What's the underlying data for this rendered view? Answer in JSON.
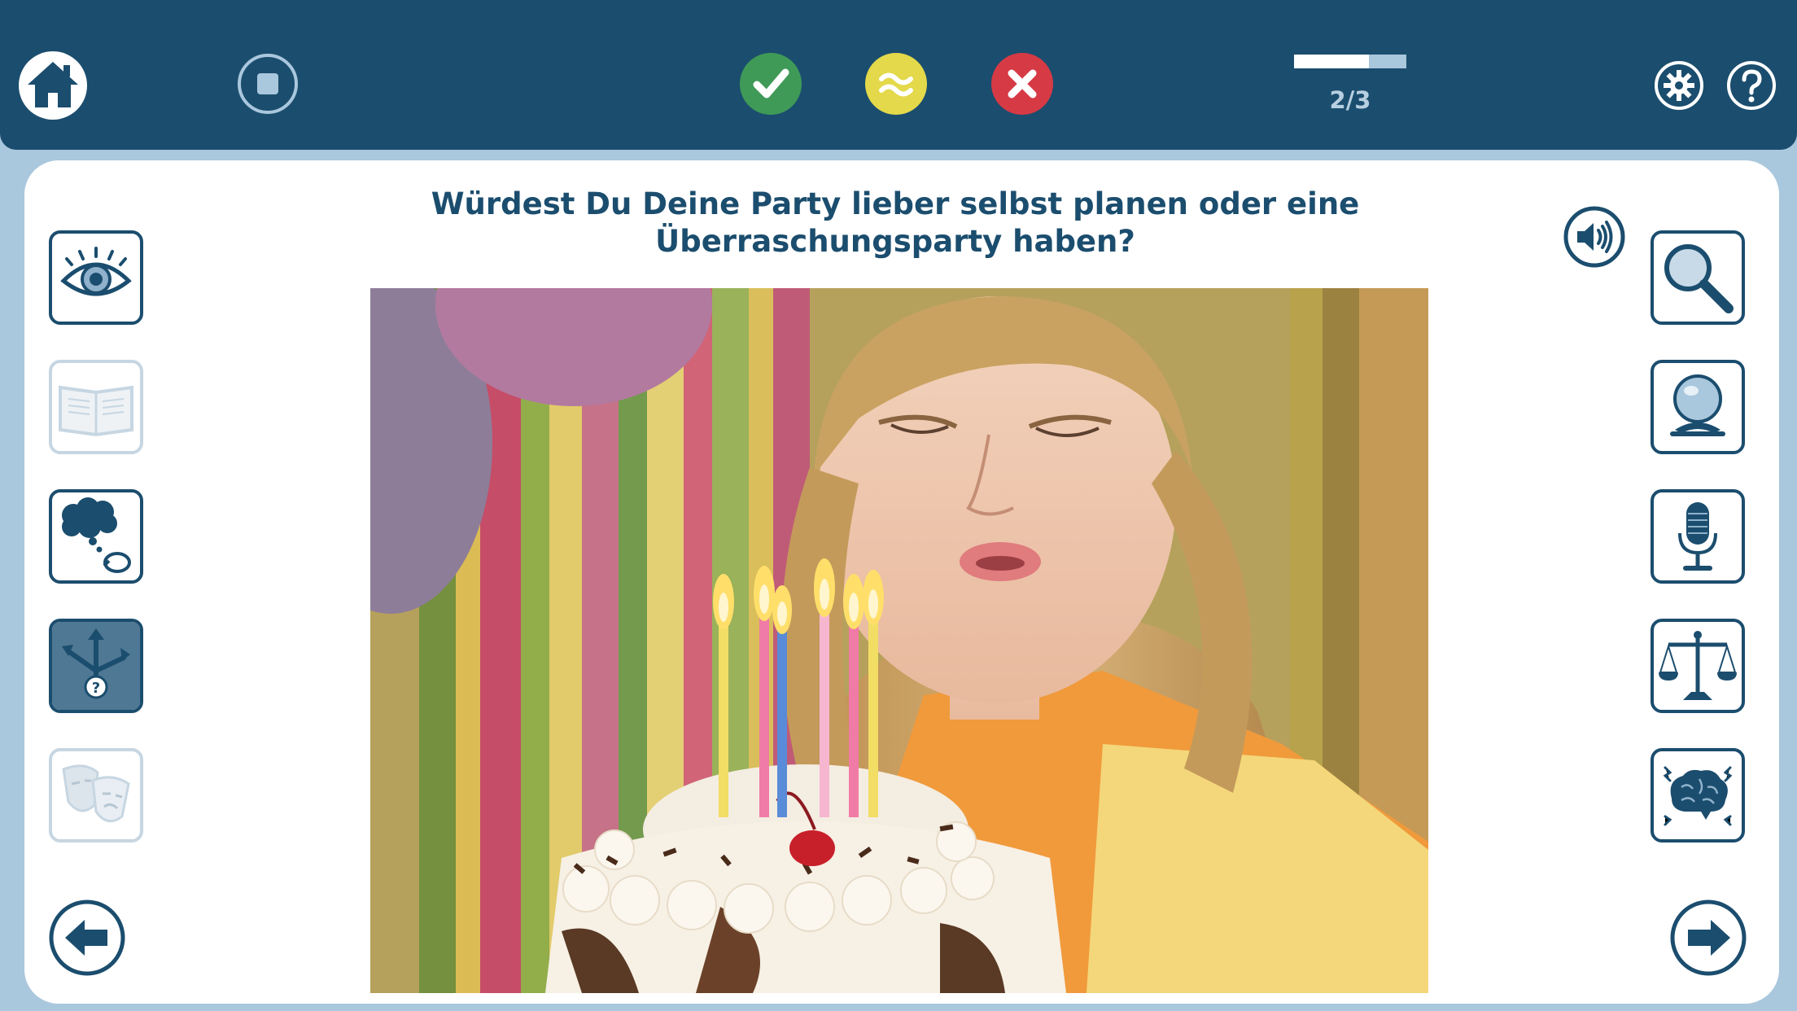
{
  "toolbar": {
    "progress": {
      "label": "2/3",
      "fraction": 0.67
    }
  },
  "question": {
    "line1": "Würdest Du Deine Party lieber selbst planen oder eine",
    "line2": "Überraschungsparty haben?"
  },
  "colors": {
    "navy": "#1b4d6e",
    "correct": "#3f9a57",
    "partial": "#e3d94a",
    "wrong": "#d63a45",
    "panel_bg": "#ffffff",
    "page_bg": "#a9c7dd"
  },
  "icons": {
    "left_tools": [
      "eye-icon",
      "dictionary-icon",
      "thought-bubble-icon",
      "choice-arrows-icon",
      "theater-masks-icon"
    ],
    "right_tools": [
      "magnifier-icon",
      "crystal-ball-icon",
      "microphone-icon",
      "scales-icon",
      "brain-icon"
    ]
  },
  "image": {
    "subject": "birthday-cake-candles-photo"
  }
}
